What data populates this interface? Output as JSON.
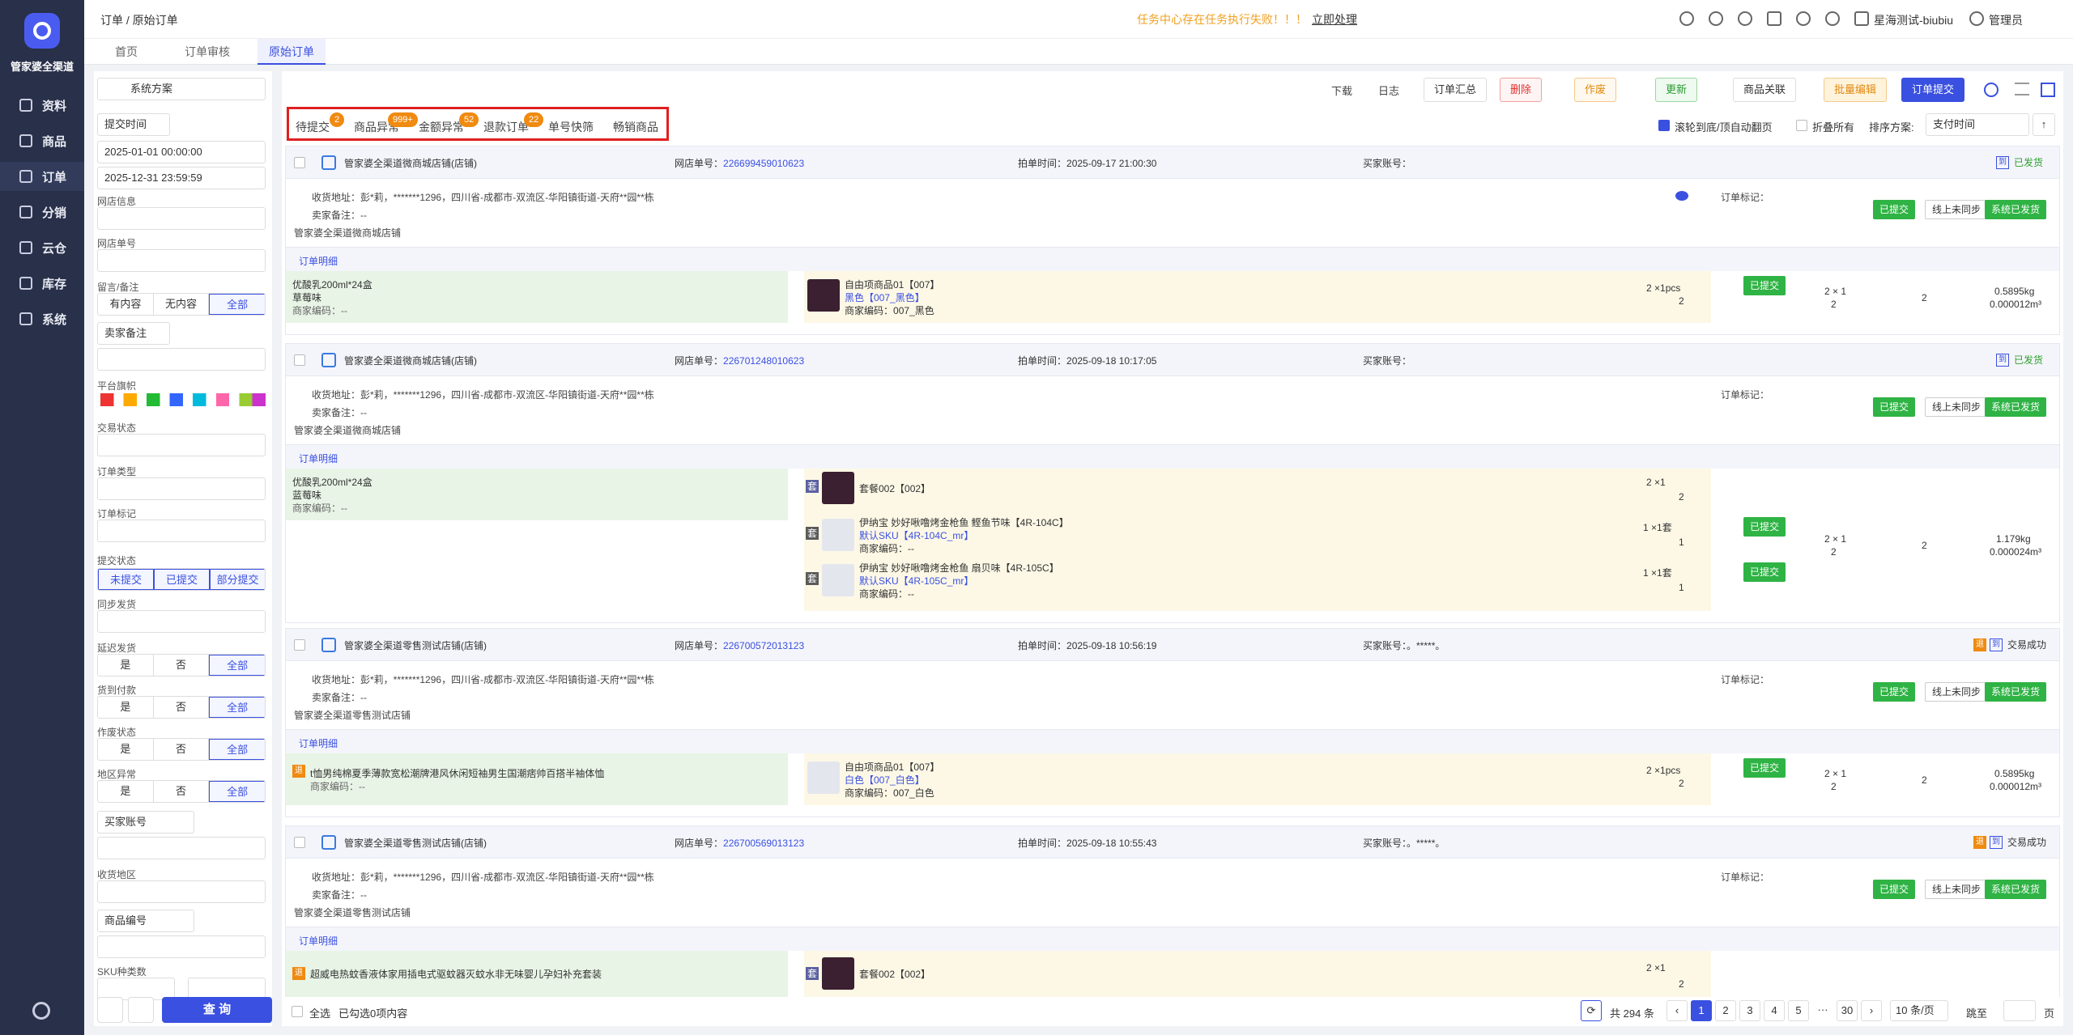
{
  "nav": {
    "brand": "管家婆全渠道",
    "items": [
      "资料",
      "商品",
      "订单",
      "分销",
      "云仓",
      "库存",
      "系统"
    ]
  },
  "topbar": {
    "breadcrumb": "订单 / 原始订单",
    "notice": "任务中心存在任务执行失败！！！",
    "notice_link": "立即处理",
    "account": "星海测试-biubiu",
    "user": "管理员"
  },
  "tabs": [
    "首页",
    "订单审核",
    "原始订单"
  ],
  "filter": {
    "scheme": "系统方案",
    "time_type": "提交时间",
    "start": "2025-01-01 00:00:00",
    "end": "2025-12-31 23:59:59",
    "labels": {
      "shop": "网店信息",
      "shop_no": "网店单号",
      "remark": "留言/备注",
      "platform_flag": "平台旗帜",
      "trade_status": "交易状态",
      "order_type": "订单类型",
      "order_mark": "订单标记",
      "submit_status": "提交状态",
      "sync": "同步发货",
      "delay": "延迟发货",
      "cod": "货到付款",
      "void": "作废状态",
      "region": "地区异常",
      "ship_area": "收货地区",
      "sku_type": "SKU种类数"
    },
    "remark_seg": [
      "有内容",
      "无内容",
      "全部"
    ],
    "seller_note": "卖家备注",
    "submit_seg": [
      "未提交",
      "已提交",
      "部分提交"
    ],
    "yes_no_all": [
      "是",
      "否",
      "全部"
    ],
    "buyer_account": "买家账号",
    "goods_no": "商品编号",
    "query": "查 询"
  },
  "toolbar": {
    "download": "下载",
    "log": "日志",
    "summary": "订单汇总",
    "delete": "删除",
    "void": "作废",
    "update": "更新",
    "goods_link": "商品关联",
    "batch_edit": "批量编辑",
    "submit": "订单提交",
    "scroll_label": "滚轮到底/顶自动翻页",
    "fold_label": "折叠所有",
    "sort_label": "排序方案:",
    "sort_value": "支付时间"
  },
  "order_tabs": [
    {
      "label": "待提交",
      "badge": "2"
    },
    {
      "label": "商品异常",
      "badge": "999+"
    },
    {
      "label": "金额异常",
      "badge": "52"
    },
    {
      "label": "退款订单",
      "badge": "22"
    },
    {
      "label": "单号快筛",
      "badge": ""
    },
    {
      "label": "畅销商品",
      "badge": ""
    }
  ],
  "common": {
    "shop_no_label": "网店单号：",
    "time_label": "拍单时间：",
    "buyer_label": "买家账号：",
    "buyer": "。*****。",
    "addr_label": "收货地址：",
    "addr": "彭*莉，*******1296，四川省-成都市-双流区-华阳镇街道-天府**园**栋",
    "seller_note_label": "卖家备注：",
    "seller_note": "--",
    "mark_label": "订单标记：",
    "detail": "订单明细",
    "submitted": "已提交",
    "sync_btn": "线上未同步",
    "sys_ship": "系统已发货",
    "merchant_code": "商家编码：",
    "dash": "--"
  },
  "orders": [
    {
      "shop": "管家婆全渠道微商城店铺(店铺)",
      "shop_no": "226699459010623",
      "time": "2025-09-17 21:00:30",
      "status": "已发货",
      "shop_name": "管家婆全渠道微商城店铺",
      "left_item": "优酸乳200ml*24盒",
      "left_spec": "草莓味",
      "right": [
        {
          "name": "自由项商品01【007】",
          "spec": "黑色【007_黑色】",
          "code": "007_黑色",
          "qty": "2 ×1pcs",
          "qty2": "2"
        }
      ],
      "c1": "2 × 1",
      "c1b": "2",
      "c2": "2",
      "weight": "0.5895kg",
      "vol": "0.000012m³"
    },
    {
      "shop": "管家婆全渠道微商城店铺(店铺)",
      "shop_no": "226701248010623",
      "time": "2025-09-18 10:17:05",
      "status": "已发货",
      "shop_name": "管家婆全渠道微商城店铺",
      "left_item": "优酸乳200ml*24盒",
      "left_spec": "蓝莓味",
      "right": [
        {
          "name": "套餐002【002】",
          "qty": "2 ×1",
          "qty2": "2"
        },
        {
          "name": "伊纳宝 妙好啾噜烤金枪鱼 鲣鱼节味【4R-104C】",
          "spec": "默认SKU【4R-104C_mr】",
          "code": "--",
          "qty": "1 ×1套",
          "qty2": "1"
        },
        {
          "name": "伊纳宝 妙好啾噜烤金枪鱼 扇贝味【4R-105C】",
          "spec": "默认SKU【4R-105C_mr】",
          "code": "--",
          "qty": "1 ×1套",
          "qty2": "1"
        }
      ],
      "c1": "2 × 1",
      "c1b": "2",
      "c2": "2",
      "weight": "1.179kg",
      "vol": "0.000024m³"
    },
    {
      "shop": "管家婆全渠道零售测试店铺(店铺)",
      "shop_no": "226700572013123",
      "time": "2025-09-18 10:56:19",
      "status": "交易成功",
      "shop_name": "管家婆全渠道零售测试店铺",
      "left_item": "t恤男纯棉夏季薄款宽松潮牌港风休闲短袖男生国潮痞帅百搭半袖体恤",
      "right": [
        {
          "name": "自由项商品01【007】",
          "spec": "白色【007_白色】",
          "code": "007_白色",
          "qty": "2 ×1pcs",
          "qty2": "2"
        }
      ],
      "c1": "2 × 1",
      "c1b": "2",
      "c2": "2",
      "weight": "0.5895kg",
      "vol": "0.000012m³"
    },
    {
      "shop": "管家婆全渠道零售测试店铺(店铺)",
      "shop_no": "226700569013123",
      "time": "2025-09-18 10:55:43",
      "status": "交易成功",
      "shop_name": "管家婆全渠道零售测试店铺",
      "left_item": "超威电热蚊香液体家用插电式驱蚊器灭蚊水非无味婴儿孕妇补充套装",
      "right": [
        {
          "name": "套餐002【002】",
          "qty": "2 ×1",
          "qty2": "2"
        }
      ]
    }
  ],
  "pager": {
    "select_all": "全选",
    "selected": "已勾选0项内容",
    "total": "共 294 条",
    "pages": [
      "1",
      "2",
      "3",
      "4",
      "5",
      "···",
      "30"
    ],
    "size": "10 条/页",
    "jump": "跳至",
    "page_unit": "页"
  }
}
